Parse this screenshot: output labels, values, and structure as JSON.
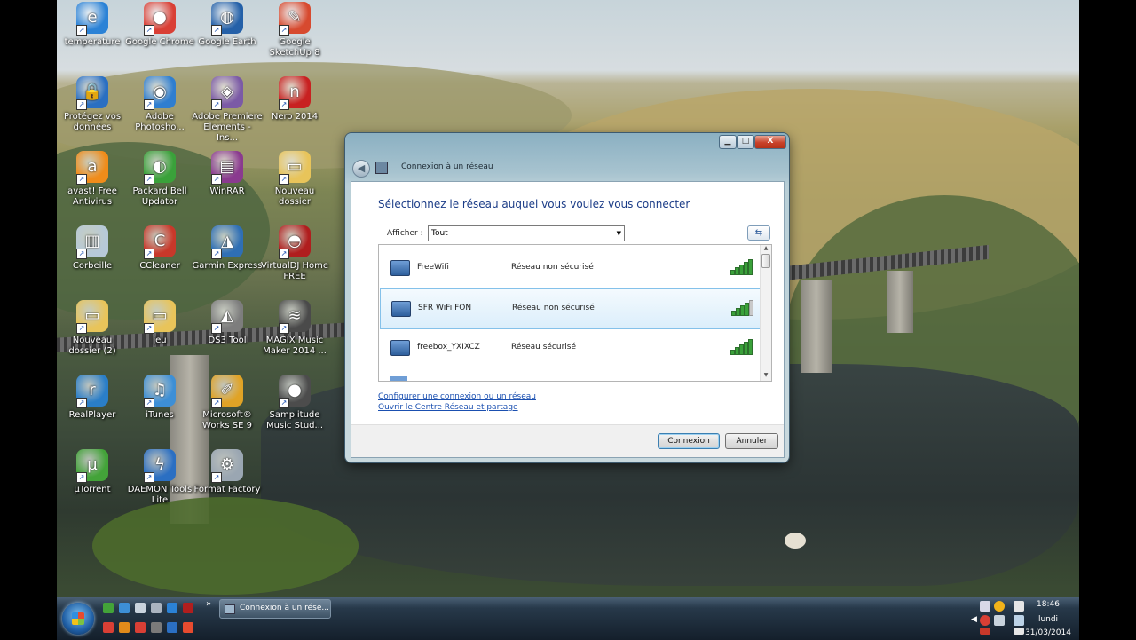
{
  "desktop": {
    "icons": [
      {
        "label": "temperature",
        "color": "#2b82d6",
        "glyph": "e"
      },
      {
        "label": "Google Chrome",
        "color": "#d93f35",
        "glyph": "●"
      },
      {
        "label": "Google Earth",
        "color": "#2460a8",
        "glyph": "◍"
      },
      {
        "label": "Google SketchUp 8",
        "color": "#d74a2f",
        "glyph": "✎"
      },
      {
        "label": "Protégez vos données",
        "color": "#2a6fc2",
        "glyph": "🔒"
      },
      {
        "label": "Adobe Photosho...",
        "color": "#2f7ed0",
        "glyph": "◉"
      },
      {
        "label": "Adobe Premiere Elements - Ins...",
        "color": "#7b5aa6",
        "glyph": "◈"
      },
      {
        "label": "Nero 2014",
        "color": "#c82121",
        "glyph": "n"
      },
      {
        "label": "avast! Free Antivirus",
        "color": "#f08c1a",
        "glyph": "a"
      },
      {
        "label": "Packard Bell Updator",
        "color": "#3aa13a",
        "glyph": "◐"
      },
      {
        "label": "WinRAR",
        "color": "#8a3a8f",
        "glyph": "▤"
      },
      {
        "label": "Nouveau dossier",
        "color": "#e8c45a",
        "glyph": "▭"
      },
      {
        "label": "Corbeille",
        "color": "#b7c9d8",
        "glyph": "▥"
      },
      {
        "label": "CCleaner",
        "color": "#c8382a",
        "glyph": "C"
      },
      {
        "label": "Garmin Express",
        "color": "#2f6fb5",
        "glyph": "◮"
      },
      {
        "label": "VirtualDJ Home FREE",
        "color": "#b01e1e",
        "glyph": "◓"
      },
      {
        "label": "Nouveau dossier (2)",
        "color": "#e8c45a",
        "glyph": "▭"
      },
      {
        "label": "jeu",
        "color": "#e8c45a",
        "glyph": "▭"
      },
      {
        "label": "DS3 Tool",
        "color": "#7d7d7d",
        "glyph": "◭"
      },
      {
        "label": "MAGIX Music Maker 2014 ...",
        "color": "#4a4a4a",
        "glyph": "≋"
      },
      {
        "label": "RealPlayer",
        "color": "#2a7ec8",
        "glyph": "r"
      },
      {
        "label": "iTunes",
        "color": "#3d8fd6",
        "glyph": "♫"
      },
      {
        "label": "Microsoft® Works SE 9",
        "color": "#e0a326",
        "glyph": "✐"
      },
      {
        "label": "Samplitude Music Stud...",
        "color": "#4c4c4c",
        "glyph": "●"
      },
      {
        "label": "µTorrent",
        "color": "#43a339",
        "glyph": "µ"
      },
      {
        "label": "DAEMON Tools Lite",
        "color": "#2b6fc2",
        "glyph": "ϟ"
      },
      {
        "label": "Format Factory",
        "color": "#9aa6b2",
        "glyph": "⚙"
      }
    ]
  },
  "dialog": {
    "title": "Connexion à un réseau",
    "heading": "Sélectionnez le réseau auquel vous voulez vous connecter",
    "filter_label": "Afficher :",
    "filter_value": "Tout",
    "networks": [
      {
        "name": "FreeWifi",
        "status": "Réseau non sécurisé",
        "signal": 5,
        "selected": false
      },
      {
        "name": "SFR WiFi FON",
        "status": "Réseau non sécurisé",
        "signal": 4,
        "selected": true
      },
      {
        "name": "freebox_YXIXCZ",
        "status": "Réseau sécurisé",
        "signal": 5,
        "selected": false
      }
    ],
    "link_configure": "Configurer une connexion ou un réseau",
    "link_center": "Ouvrir le Centre Réseau et partage",
    "connect_label": "Connexion",
    "cancel_label": "Annuler",
    "window_buttons": {
      "minimize": "▁",
      "maximize": "□",
      "close": "X"
    },
    "refresh_icon": "⇆"
  },
  "taskbar": {
    "task_label": "Connexion à un rése...",
    "overflow": "»",
    "clock_time": "18:46",
    "clock_day": "lundi",
    "clock_date": "31/03/2014"
  },
  "colors": {
    "accent": "#1a4fb0",
    "signal": "#3aa13a",
    "selection": "#dbeefb"
  }
}
